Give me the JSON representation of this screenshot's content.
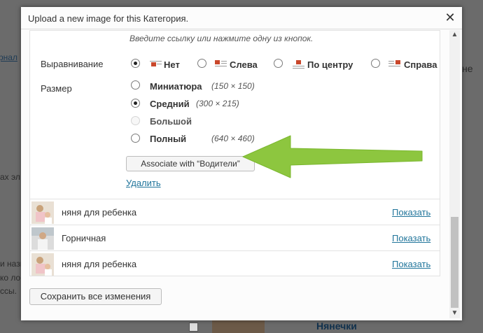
{
  "background": {
    "left_fragments": [
      "рнал",
      "ах эл",
      "и назв",
      "ко ло",
      "ссы."
    ],
    "right_fragment": "не",
    "bottom_heading": "Нянечки"
  },
  "modal": {
    "title": "Upload a new image for this Категория.",
    "close_symbol": "✕",
    "hint": "Введите ссылку или нажмите одну из кнопок.",
    "alignment": {
      "label": "Выравнивание",
      "options": [
        "Нет",
        "Слева",
        "По центру",
        "Справа"
      ],
      "selected": "Нет"
    },
    "size": {
      "label": "Размер",
      "options": [
        {
          "name": "Миниатюра",
          "dims": "(150 × 150)",
          "selected": false,
          "disabled": false
        },
        {
          "name": "Средний",
          "dims": "(300 × 215)",
          "selected": true,
          "disabled": false
        },
        {
          "name": "Большой",
          "dims": "",
          "selected": false,
          "disabled": true
        },
        {
          "name": "Полный",
          "dims": "(640 × 460)",
          "selected": false,
          "disabled": false
        }
      ]
    },
    "associate_button": "Associate with “Водители”",
    "delete_link": "Удалить",
    "rows": [
      {
        "title": "няня для ребенка",
        "action": "Показать"
      },
      {
        "title": "Горничная",
        "action": "Показать"
      },
      {
        "title": "няня для ребенка",
        "action": "Показать"
      }
    ],
    "save_button": "Сохранить все изменения"
  },
  "colors": {
    "accent_arrow": "#8dc63f",
    "link": "#21759b"
  }
}
